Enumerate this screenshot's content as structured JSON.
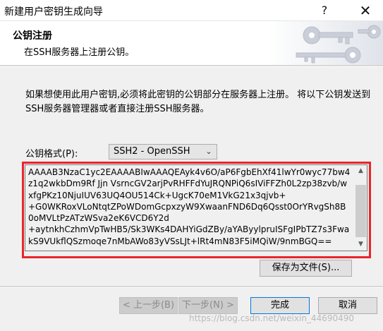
{
  "window": {
    "title": "新建用户密钥生成向导",
    "help_glyph": "?",
    "close_glyph": "✕"
  },
  "header": {
    "title": "公钥注册",
    "subtitle": "在SSH服务器上注册公钥。",
    "art_icon": "keys-icon"
  },
  "body": {
    "instruction": "如果想使用此用户密钥,必须将此密钥的公钥部分在服务器上注册。 将以下公钥发送到SSH服务器管理器或者直接注册SSH服务器。",
    "format_label": "公钥格式(P):",
    "format_value": "SSH2 - OpenSSH",
    "key_text": "AAAAB3NzaC1yc2EAAAABIwAAAQEAyk4v6O/aP6FgbEhXf41lwYr0wyc77bw4z1q2wkbDm9Rf Jjn VsrncGV2arjPvRHFFdYuJRQNPiQ6sIViFFZh0L2zp38zvb/wxfgPKz10NjuIUV63UQ4OU514Ck+UgcK70eM1VkG21x3qjvb+\n+G0WKRoxVLoNtqtZPoWDomGcpxzyW9XwaanFND6Dq6Qsst0OrYRvgSh8B0oMVLtPzATzWSva2eK6VCD6Y2d\n+aytnkhCzhmVpTwHB5/Sk3WKs4DAHYiGdZBy/aYAByylpruISFgIPbTZ7s3FwakS9VUkflQSzmoqe7nMbAWo83yVSsLJt+lRt4mN83F5iMQiW/9nmBGQ==",
    "save_label": "保存为文件(S)..."
  },
  "footer": {
    "back_label": "< 上一步(B)",
    "next_label": "下一步(N) >",
    "finish_label": "完成",
    "cancel_label": "取消"
  },
  "watermark": "https://blog.csdn.net/weixin_44690490",
  "colors": {
    "highlight_border": "#e8262b",
    "dialog_bg": "#f0f0f0"
  }
}
